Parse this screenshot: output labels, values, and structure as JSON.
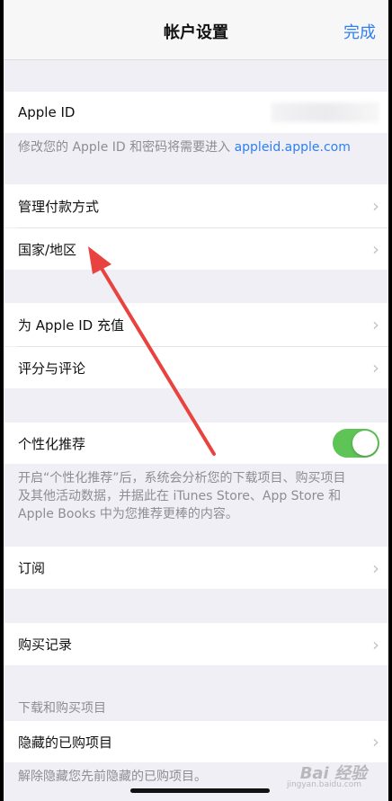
{
  "nav": {
    "title": "帐户设置",
    "done_label": "完成"
  },
  "apple_id": {
    "label": "Apple ID",
    "footnote_text": "修改您的 Apple ID 和密码将需要进入 ",
    "footnote_link": "appleid.apple.com"
  },
  "payment": {
    "label": "管理付款方式",
    "icon": "chevron-right-icon"
  },
  "region": {
    "label": "国家/地区",
    "icon": "chevron-right-icon"
  },
  "topup": {
    "label": "为 Apple ID 充值",
    "icon": "chevron-right-icon"
  },
  "ratings": {
    "label": "评分与评论",
    "icon": "chevron-right-icon"
  },
  "personalized": {
    "label": "个性化推荐",
    "toggle_on": true,
    "toggle_color": "#5ec456",
    "footnote_lines": [
      "开启“个性化推荐”后，系统会分析您的下载项目、购买项目",
      "及其他活动数据，并据此在 iTunes Store、App Store 和",
      "Apple Books 中为您推荐更棒的内容。"
    ]
  },
  "subscriptions": {
    "label": "订阅",
    "icon": "chevron-right-icon"
  },
  "purchase_history": {
    "label": "购买记录",
    "icon": "chevron-right-icon"
  },
  "downloads_section": {
    "header": "下载和购买项目",
    "hidden_label": "隐藏的已购项目",
    "hidden_footnote": "解除隐藏您先前隐藏的已购项目。"
  },
  "watermark": {
    "text": "Bai 经验",
    "sub": "jingyan.baidu.com"
  },
  "colors": {
    "accent": "#2f7ff1",
    "annotation": "#e8433f",
    "background": "#f0eff5"
  }
}
